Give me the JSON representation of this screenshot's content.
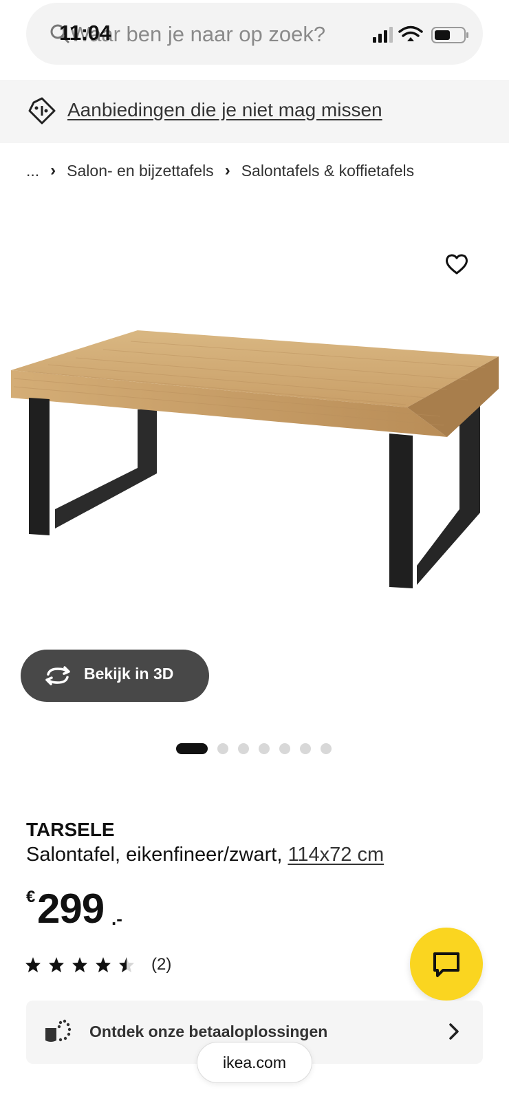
{
  "status_bar": {
    "time": "11:04"
  },
  "search": {
    "placeholder": "Waar ben je naar op zoek?"
  },
  "deals_banner": {
    "label": "Aanbiedingen die je niet mag missen",
    "icon": "price-tag-icon"
  },
  "breadcrumb": {
    "items": [
      "...",
      "Salon- en bijzettafels",
      "Salontafels & koffietafels"
    ],
    "separator": "›"
  },
  "gallery": {
    "view_3d_label": "Bekijk in 3D",
    "total_images": 7,
    "active_index": 0
  },
  "product": {
    "name": "TARSELE",
    "description": "Salontafel, eikenfineer/zwart,",
    "size": "114x72 cm",
    "price_currency": "€",
    "price_amount": "299",
    "price_suffix": ".-",
    "rating": 4.5,
    "rating_max": 5,
    "review_count": "(2)"
  },
  "payment": {
    "label": "Ontdek onze betaaloplossingen"
  },
  "browser": {
    "url": "ikea.com"
  },
  "colors": {
    "accent_yellow": "#fad520",
    "button_dark": "#484848",
    "banner_bg": "#f5f5f5",
    "wood": "#d2ac79"
  }
}
